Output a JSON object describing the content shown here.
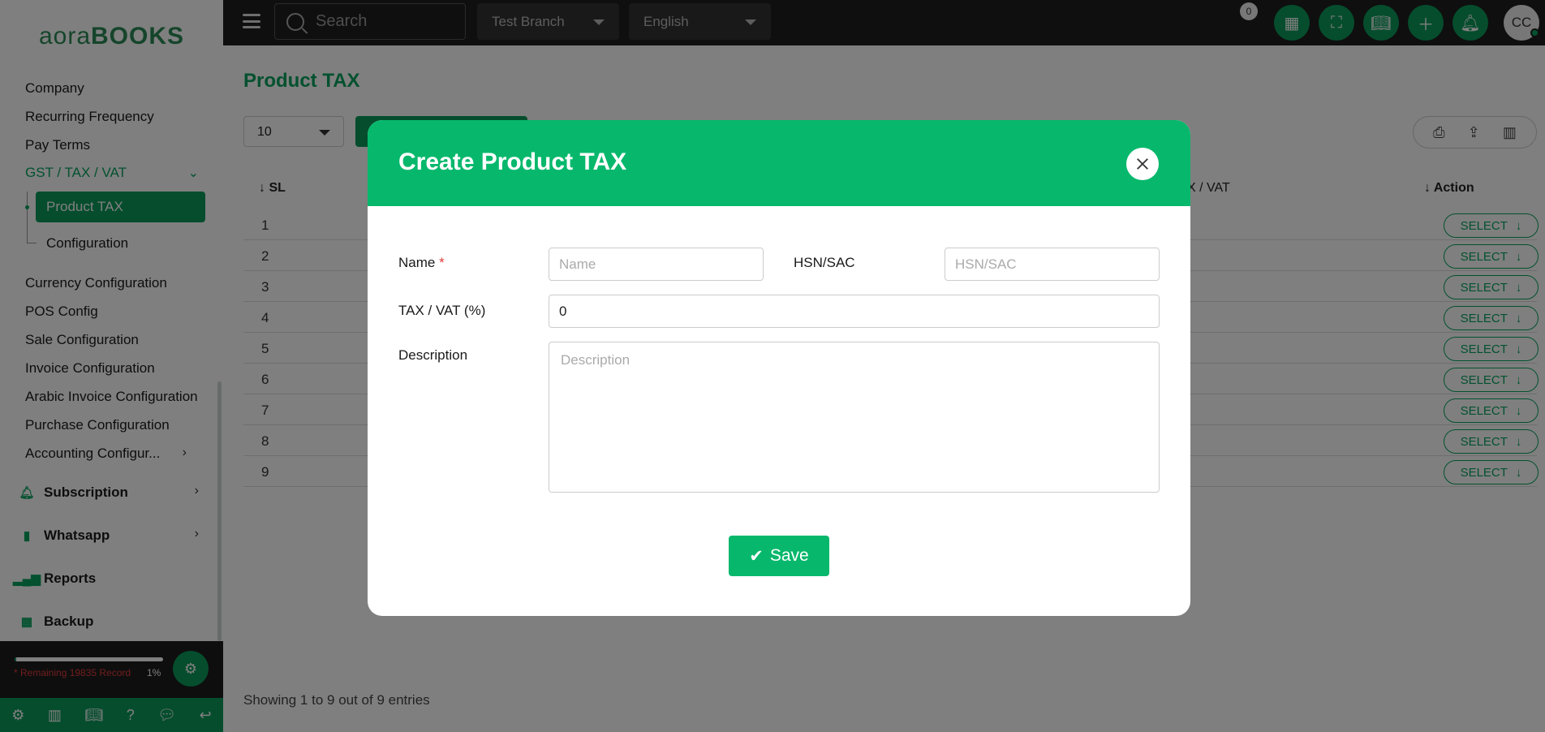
{
  "logo": {
    "part1": "aora",
    "part2": "BOOKS"
  },
  "sidebar": {
    "items": [
      {
        "label": "Company"
      },
      {
        "label": "Recurring Frequency"
      },
      {
        "label": "Pay Terms"
      },
      {
        "label": "GST / TAX / VAT"
      }
    ],
    "sub_items": [
      {
        "label": "Product TAX"
      },
      {
        "label": "Configuration"
      }
    ],
    "items2": [
      {
        "label": "Currency Configuration"
      },
      {
        "label": "POS Config"
      },
      {
        "label": "Sale Configuration"
      },
      {
        "label": "Invoice Configuration"
      },
      {
        "label": "Arabic Invoice Configuration"
      },
      {
        "label": "Purchase Configuration"
      },
      {
        "label": "Accounting Configur..."
      }
    ],
    "sections": [
      {
        "label": "Subscription"
      },
      {
        "label": "Whatsapp"
      },
      {
        "label": "Reports"
      },
      {
        "label": "Backup"
      }
    ],
    "remaining_text": "* Remaining 19835 Record",
    "progress_pct_label": "1%",
    "progress_fraction": 0.01
  },
  "topbar": {
    "search_placeholder": "Search",
    "branch": "Test Branch",
    "language": "English",
    "notif_count": "0",
    "avatar_initials": "CC"
  },
  "page": {
    "title": "Product TAX",
    "per_page": "10",
    "columns": {
      "sl": "↓ SL",
      "tax": "X / VAT",
      "action": "↓ Action"
    },
    "rows": [
      "1",
      "2",
      "3",
      "4",
      "5",
      "6",
      "7",
      "8",
      "9"
    ],
    "row_action_label": "SELECT",
    "showing": "Showing 1 to 9 out of 9 entries"
  },
  "modal": {
    "title": "Create Product TAX",
    "name_label": "Name",
    "name_required": "*",
    "name_placeholder": "Name",
    "hsn_label": "HSN/SAC",
    "hsn_placeholder": "HSN/SAC",
    "tax_label": "TAX / VAT (%)",
    "tax_value": "0",
    "desc_label": "Description",
    "desc_placeholder": "Description",
    "save_label": "Save"
  },
  "colors": {
    "brand": "#07b86c",
    "brand_dark": "#0a9a5a",
    "topbar": "#1f1f1f"
  }
}
